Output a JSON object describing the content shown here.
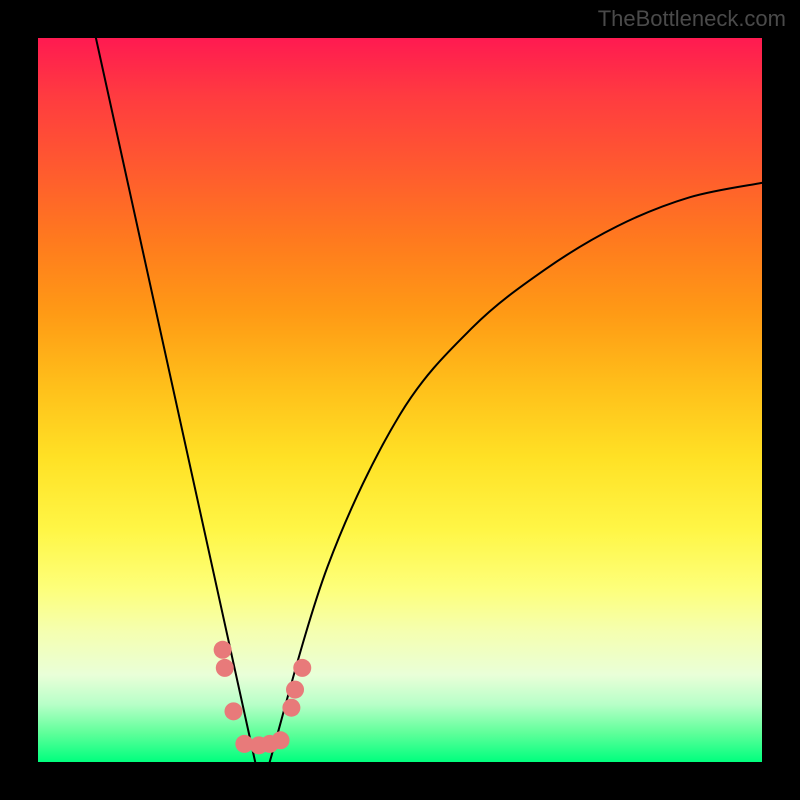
{
  "watermark": "TheBottleneck.com",
  "chart_data": {
    "type": "line",
    "title": "",
    "xlabel": "",
    "ylabel": "",
    "xlim": [
      0,
      100
    ],
    "ylim": [
      0,
      100
    ],
    "background": "gradient-bottleneck",
    "curve_description": "V-shaped bottleneck curve with minimum near x=30; left branch steep line from top-left, right branch concave curve rising to upper-right",
    "left_branch": [
      {
        "x": 8,
        "y": 100
      },
      {
        "x": 30,
        "y": 0
      }
    ],
    "right_branch": [
      {
        "x": 32,
        "y": 0
      },
      {
        "x": 40,
        "y": 27
      },
      {
        "x": 50,
        "y": 48
      },
      {
        "x": 60,
        "y": 60
      },
      {
        "x": 70,
        "y": 68
      },
      {
        "x": 80,
        "y": 74
      },
      {
        "x": 90,
        "y": 78
      },
      {
        "x": 100,
        "y": 80
      }
    ],
    "markers": {
      "color": "#e87a7a",
      "points": [
        {
          "x": 25.5,
          "y": 15.5
        },
        {
          "x": 25.8,
          "y": 13
        },
        {
          "x": 27,
          "y": 7
        },
        {
          "x": 28.5,
          "y": 2.5
        },
        {
          "x": 30.5,
          "y": 2.3
        },
        {
          "x": 32,
          "y": 2.5
        },
        {
          "x": 33.5,
          "y": 3
        },
        {
          "x": 35,
          "y": 7.5
        },
        {
          "x": 35.5,
          "y": 10
        },
        {
          "x": 36.5,
          "y": 13
        }
      ]
    }
  }
}
